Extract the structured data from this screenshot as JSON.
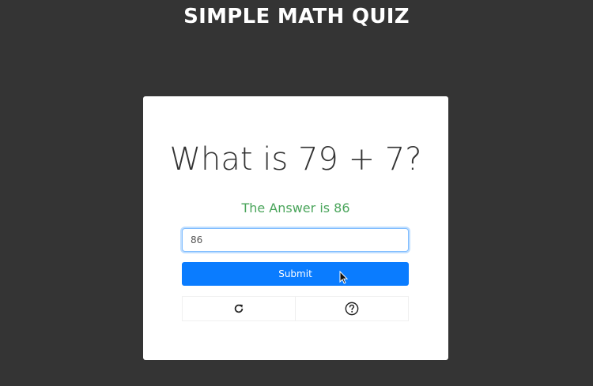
{
  "app": {
    "title": "SIMPLE MATH QUIZ"
  },
  "quiz": {
    "question": "What is 79 + 7?",
    "feedback": "The Answer is 86",
    "answer_value": "86",
    "submit_label": "Submit"
  },
  "actions": {
    "refresh_icon": "refresh-icon",
    "help_icon": "help-circle-icon"
  },
  "colors": {
    "background": "#343434",
    "card": "#ffffff",
    "primary": "#0a7cff",
    "feedback_correct": "#4aa55b"
  }
}
